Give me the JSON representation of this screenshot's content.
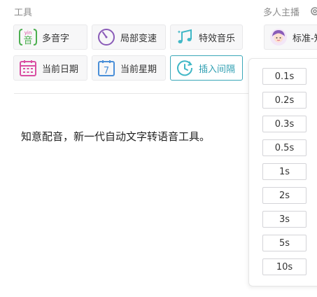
{
  "tools": {
    "title": "工具",
    "buttons": [
      {
        "label": "多音字",
        "icon": "yin-pronunciation-icon",
        "icon_text": "音",
        "icon_sup": "yin"
      },
      {
        "label": "局部变速",
        "icon": "speed-gauge-icon"
      },
      {
        "label": "特效音乐",
        "icon": "music-notes-icon"
      },
      {
        "label": "当前日期",
        "icon": "calendar-icon"
      },
      {
        "label": "当前星期",
        "icon": "week-calendar-icon",
        "icon_text": "7"
      },
      {
        "label": "插入间隔",
        "icon": "clock-interval-icon",
        "active": true
      }
    ]
  },
  "anchor": {
    "title": "多人主播",
    "selected_voice": "标准-知"
  },
  "editor": {
    "content": "知意配音，新一代自动文字转语音工具。"
  },
  "interval_dropdown": {
    "options": [
      "0.1s",
      "0.2s",
      "0.3s",
      "0.5s",
      "1s",
      "2s",
      "3s",
      "5s",
      "10s"
    ]
  },
  "colors": {
    "accent": "#3aa7b8",
    "pink": "#d94fa2",
    "purple": "#8a5bb8",
    "cyan": "#3fb7c6",
    "blue": "#4a8fd8",
    "muted_text": "#8c8c8c"
  }
}
